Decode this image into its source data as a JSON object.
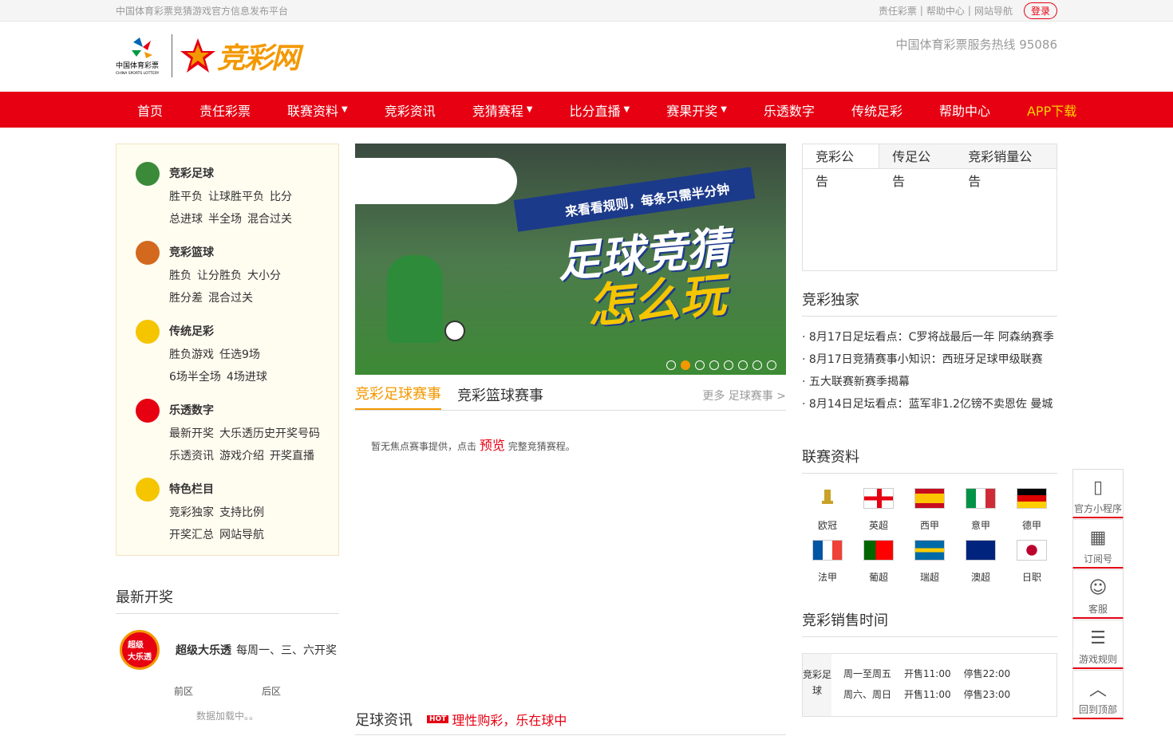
{
  "topbar": {
    "slogan": "中国体育彩票竞猜游戏官方信息发布平台",
    "links": [
      "责任彩票",
      "帮助中心",
      "网站导航"
    ],
    "login": "登录"
  },
  "header": {
    "cs_logo_text": "中国体育彩票",
    "cs_logo_en": "CHINA SPORTS LOTTERY",
    "brand": "竞彩网",
    "hotline": "中国体育彩票服务热线 95086"
  },
  "nav": [
    {
      "label": "首页"
    },
    {
      "label": "责任彩票"
    },
    {
      "label": "联赛资料",
      "arrow": "▼"
    },
    {
      "label": "竞彩资讯"
    },
    {
      "label": "竞猜赛程",
      "arrow": "▼"
    },
    {
      "label": "比分直播",
      "arrow": "▼"
    },
    {
      "label": "赛果开奖",
      "arrow": "▼"
    },
    {
      "label": "乐透数字"
    },
    {
      "label": "传统足彩"
    },
    {
      "label": "帮助中心"
    },
    {
      "label": "APP下载"
    }
  ],
  "games": [
    {
      "title": "竞彩足球",
      "rows": [
        [
          "胜平负",
          "让球胜平负",
          "比分"
        ],
        [
          "总进球",
          "半全场",
          "混合过关"
        ]
      ]
    },
    {
      "title": "竞彩篮球",
      "rows": [
        [
          "胜负",
          "让分胜负",
          "大小分"
        ],
        [
          "胜分差",
          "混合过关"
        ]
      ]
    },
    {
      "title": "传统足彩",
      "rows": [
        [
          "胜负游戏",
          "任选9场"
        ],
        [
          "6场半全场",
          "4场进球"
        ]
      ]
    },
    {
      "title": "乐透数字",
      "rows": [
        [
          "最新开奖",
          "大乐透历史开奖号码"
        ],
        [
          "乐透资讯",
          "游戏介绍",
          "开奖直播"
        ]
      ]
    },
    {
      "title": "特色栏目",
      "rows": [
        [
          "竞彩独家",
          "支持比例"
        ],
        [
          "开奖汇总",
          "网站导航"
        ]
      ]
    }
  ],
  "latest": {
    "title": "最新开奖",
    "name": "超级大乐透",
    "schedule": "每周一、三、六开奖",
    "front": "前区",
    "back": "后区",
    "loading": "数据加载中。。"
  },
  "banner": {
    "sub": "来看看规则，每条只需半分钟",
    "big1": "足球竞猜",
    "big2": "怎么玩",
    "dots": 8,
    "active": 1
  },
  "matchtabs": {
    "tabs": [
      "竞彩足球赛事",
      "竞彩篮球赛事"
    ],
    "more": "更多 足球赛事 >",
    "nofocus_a": "暂无焦点赛事提供，点击",
    "preview": "预览",
    "nofocus_b": "完整竞猜赛程。"
  },
  "news": {
    "title": "足球资讯",
    "hot": "HOT",
    "slogan": "理性购彩，乐在球中"
  },
  "notice": {
    "tabs": [
      "竞彩公告",
      "传足公告",
      "竞彩销量公告"
    ]
  },
  "exclusive": {
    "title": "竞彩独家",
    "items": [
      "8月17日足坛看点：C罗将战最后一年 阿森纳赛季",
      "8月17日竞猜赛事小知识：西班牙足球甲级联赛",
      "五大联赛新赛季揭幕",
      "8月14日足坛看点：蓝军非1.2亿镑不卖恩佐 曼城"
    ]
  },
  "leagues": {
    "title": "联赛资料",
    "items": [
      "欧冠",
      "英超",
      "西甲",
      "意甲",
      "德甲",
      "法甲",
      "葡超",
      "瑞超",
      "澳超",
      "日职"
    ]
  },
  "sales": {
    "title": "竞彩销售时间",
    "label": "竞彩足球",
    "rows": [
      [
        "周一至周五",
        "开售11:00",
        "停售22:00"
      ],
      [
        "周六、周日",
        "开售11:00",
        "停售23:00"
      ]
    ]
  },
  "side": [
    "官方小程序",
    "订阅号",
    "客服",
    "游戏规则",
    "回到顶部"
  ],
  "colors": {
    "primary": "#e60012",
    "accent": "#f39800"
  }
}
